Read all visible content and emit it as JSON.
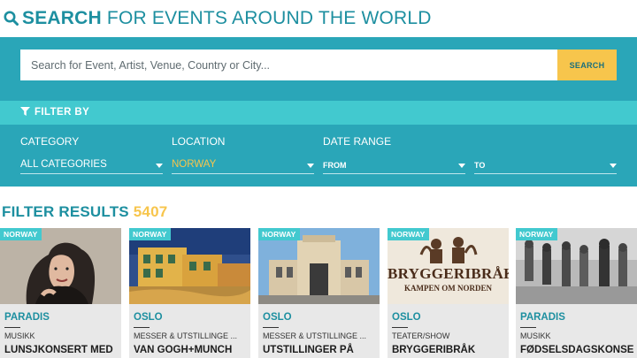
{
  "header": {
    "title_strong": "SEARCH",
    "title_rest": " FOR EVENTS AROUND THE WORLD"
  },
  "search": {
    "placeholder": "Search for Event, Artist, Venue, Country or City...",
    "button_label": "SEARCH"
  },
  "filter_bar": {
    "label": "FILTER BY"
  },
  "filters": {
    "category": {
      "label": "CATEGORY",
      "value": "ALL CATEGORIES"
    },
    "location": {
      "label": "LOCATION",
      "value": "NORWAY"
    },
    "date_range": {
      "label": "DATE RANGE",
      "from": "FROM",
      "to": "TO"
    }
  },
  "results": {
    "label": "FILTER RESULTS",
    "count": "5407"
  },
  "cards": [
    {
      "badge": "NORWAY",
      "city": "PARADIS",
      "category": "MUSIKK",
      "title": "LUNSJKONSERT MED"
    },
    {
      "badge": "NORWAY",
      "city": "OSLO",
      "category": "MESSER & UTSTILLINGE ...",
      "title": "VAN GOGH+MUNCH"
    },
    {
      "badge": "NORWAY",
      "city": "OSLO",
      "category": "MESSER & UTSTILLINGE ...",
      "title": "UTSTILLINGER PÅ"
    },
    {
      "badge": "NORWAY",
      "city": "OSLO",
      "category": "TEATER/SHOW",
      "title": "BRYGGERIBRÅK",
      "poster_title": "BRYGGERIBRÅK",
      "poster_subtitle": "KAMPEN OM NORDEN"
    },
    {
      "badge": "NORWAY",
      "city": "PARADIS",
      "category": "MUSIKK",
      "title": "FØDSELSDAGSKONSE"
    }
  ],
  "colors": {
    "brand": "#2aa6b8",
    "accent": "#f7c54c",
    "bar": "#42c9cf",
    "title": "#1d8fa0"
  },
  "icons": {
    "header": "search-icon",
    "filter": "funnel-icon",
    "dropdown": "chevron-down-icon"
  }
}
